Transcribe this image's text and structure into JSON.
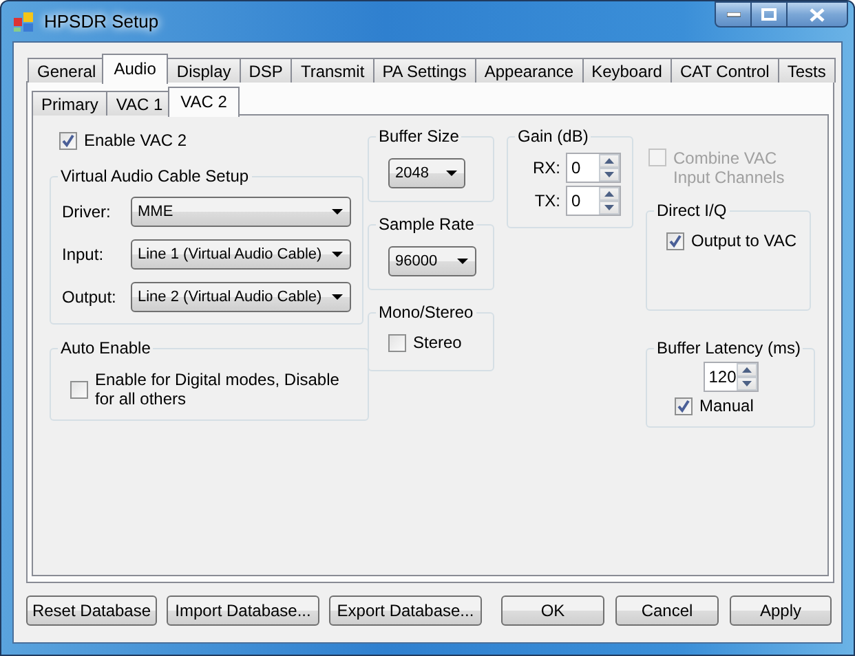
{
  "window": {
    "title": "HPSDR Setup"
  },
  "tabs": [
    {
      "label": "General",
      "selected": false
    },
    {
      "label": "Audio",
      "selected": true
    },
    {
      "label": "Display",
      "selected": false
    },
    {
      "label": "DSP",
      "selected": false
    },
    {
      "label": "Transmit",
      "selected": false
    },
    {
      "label": "PA Settings",
      "selected": false
    },
    {
      "label": "Appearance",
      "selected": false
    },
    {
      "label": "Keyboard",
      "selected": false
    },
    {
      "label": "CAT Control",
      "selected": false
    },
    {
      "label": "Tests",
      "selected": false
    }
  ],
  "subtabs": [
    {
      "label": "Primary",
      "selected": false
    },
    {
      "label": "VAC 1",
      "selected": false
    },
    {
      "label": "VAC 2",
      "selected": true
    }
  ],
  "enable_vac": {
    "label": "Enable VAC 2",
    "checked": true
  },
  "vac_setup": {
    "title": "Virtual Audio Cable Setup",
    "fields": [
      {
        "label": "Driver:",
        "value": "MME"
      },
      {
        "label": "Input:",
        "value": "Line 1 (Virtual Audio Cable)"
      },
      {
        "label": "Output:",
        "value": "Line 2 (Virtual Audio Cable)"
      }
    ]
  },
  "auto_enable": {
    "title": "Auto Enable",
    "checkbox": {
      "label": "Enable for Digital modes, Disable for all others",
      "checked": false
    }
  },
  "buffer_size": {
    "title": "Buffer Size",
    "value": "2048"
  },
  "sample_rate": {
    "title": "Sample Rate",
    "value": "96000"
  },
  "mono_stereo": {
    "title": "Mono/Stereo",
    "checkbox": {
      "label": "Stereo",
      "checked": false
    }
  },
  "gain": {
    "title": "Gain (dB)",
    "fields": [
      {
        "label": "RX:",
        "value": "0"
      },
      {
        "label": "TX:",
        "value": "0"
      }
    ]
  },
  "combine_vac": {
    "label": "Combine VAC Input Channels",
    "checked": false,
    "disabled": true
  },
  "direct_iq": {
    "title": "Direct I/Q",
    "checkbox": {
      "label": "Output to VAC",
      "checked": true
    }
  },
  "buffer_latency": {
    "title": "Buffer Latency (ms)",
    "value": "120",
    "checkbox": {
      "label": "Manual",
      "checked": true
    }
  },
  "left_buttons": [
    "Reset Database",
    "Import Database...",
    "Export Database..."
  ],
  "right_buttons": [
    "OK",
    "Cancel",
    "Apply"
  ]
}
